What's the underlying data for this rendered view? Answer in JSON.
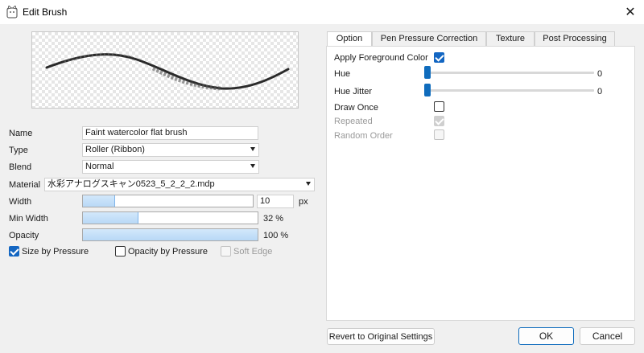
{
  "window": {
    "title": "Edit Brush",
    "icon": "cat-app-icon"
  },
  "left": {
    "name": {
      "label": "Name",
      "value": "Faint watercolor flat brush"
    },
    "type": {
      "label": "Type",
      "value": "Roller (Ribbon)"
    },
    "blend": {
      "label": "Blend",
      "value": "Normal"
    },
    "material": {
      "label": "Material",
      "value": "水彩アナログスキャン0523_5_2_2_2.mdp"
    },
    "width": {
      "label": "Width",
      "value": "10",
      "unit": "px",
      "level_fraction": 0.19
    },
    "min_width": {
      "label": "Min Width",
      "value_text": "32 %",
      "level_fraction": 0.32
    },
    "opacity": {
      "label": "Opacity",
      "value_text": "100 %",
      "level_fraction": 1.0
    },
    "checks": {
      "size_by_pressure": {
        "label": "Size by Pressure",
        "checked": true,
        "enabled": true
      },
      "opacity_by_pressure": {
        "label": "Opacity by Pressure",
        "checked": false,
        "enabled": true
      },
      "soft_edge": {
        "label": "Soft Edge",
        "checked": false,
        "enabled": false
      }
    }
  },
  "tabs": [
    "Option",
    "Pen Pressure Correction",
    "Texture",
    "Post Processing"
  ],
  "active_tab": "Option",
  "option": {
    "apply_fg": {
      "label": "Apply Foreground Color",
      "checked": true
    },
    "hue": {
      "label": "Hue",
      "value": "0",
      "level_fraction": 0.0
    },
    "hue_jitter": {
      "label": "Hue Jitter",
      "value": "0",
      "level_fraction": 0.0
    },
    "draw_once": {
      "label": "Draw Once",
      "checked": false
    },
    "repeated": {
      "label": "Repeated",
      "checked": true,
      "enabled": false
    },
    "random_order": {
      "label": "Random Order",
      "checked": false,
      "enabled": false
    }
  },
  "buttons": {
    "revert": "Revert to Original Settings",
    "ok": "OK",
    "cancel": "Cancel"
  },
  "colors": {
    "accent": "#0f6cbd",
    "bar_fill": "#b8d8f6"
  }
}
